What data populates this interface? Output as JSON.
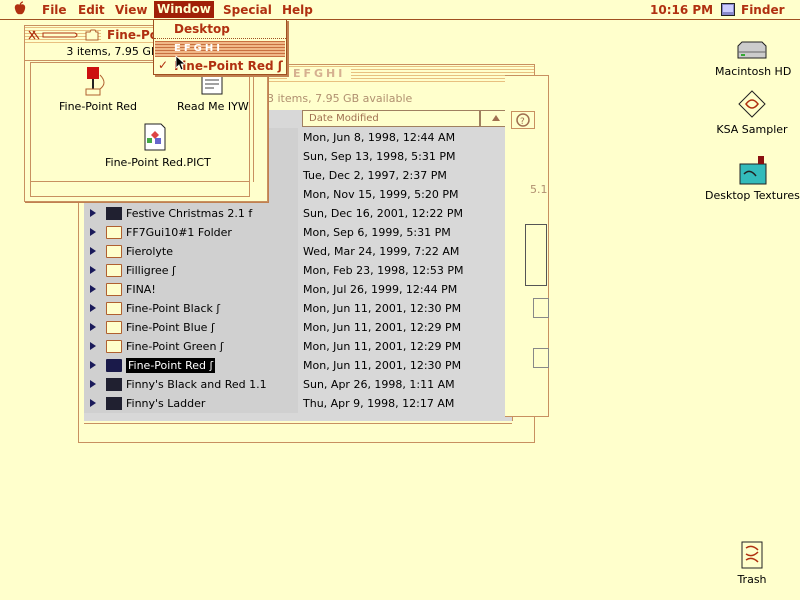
{
  "menubar": {
    "items": [
      "File",
      "Edit",
      "View",
      "Window",
      "Special",
      "Help"
    ],
    "time": "10:16 PM",
    "app": "Finder"
  },
  "window_menu": {
    "items": [
      "Desktop",
      "EFGHI",
      "Fine-Point Red ʃ"
    ]
  },
  "front_window": {
    "title": "Fine-Point Red ʃ",
    "info": "3 items, 7.95 GB available",
    "files": [
      "Fine-Point Red",
      "Read Me IYW",
      "Fine-Point Red.PICT"
    ]
  },
  "back_window": {
    "title": "EFGHI",
    "info": "3 items, 7.95 GB available",
    "column_date": "Date Modified",
    "rows": [
      {
        "name": "",
        "date": "Mon, Jun 8, 1998, 12:44 AM"
      },
      {
        "name": "",
        "date": "Sun, Sep 13, 1998, 5:31 PM"
      },
      {
        "name": "",
        "date": "Tue, Dec 2, 1997, 2:37 PM"
      },
      {
        "name": "",
        "date": "Mon, Nov 15, 1999, 5:20 PM"
      },
      {
        "name": "Festive Christmas 2.1 f",
        "date": "Sun, Dec 16, 2001, 12:22 PM"
      },
      {
        "name": "FF7Gui10#1 Folder",
        "date": "Mon, Sep 6, 1999, 5:31 PM"
      },
      {
        "name": "Fierolyte",
        "date": "Wed, Mar 24, 1999, 7:22 AM"
      },
      {
        "name": "Filligree ʃ",
        "date": "Mon, Feb 23, 1998, 12:53 PM"
      },
      {
        "name": "FINA!",
        "date": "Mon, Jul 26, 1999, 12:44 PM"
      },
      {
        "name": "Fine-Point Black ʃ",
        "date": "Mon, Jun 11, 2001, 12:30 PM"
      },
      {
        "name": "Fine-Point Blue ʃ",
        "date": "Mon, Jun 11, 2001, 12:29 PM"
      },
      {
        "name": "Fine-Point Green ʃ",
        "date": "Mon, Jun 11, 2001, 12:29 PM"
      },
      {
        "name": "Fine-Point Red ʃ",
        "date": "Mon, Jun 11, 2001, 12:30 PM"
      },
      {
        "name": "Finny's Black and Red 1.1",
        "date": "Sun, Apr 26, 1998, 1:11 AM"
      },
      {
        "name": "Finny's Ladder",
        "date": "Thu, Apr 9, 1998, 12:17 AM"
      }
    ]
  },
  "mid_window": {
    "fragment": "5.1"
  },
  "desktop_icons": [
    "Macintosh HD",
    "KSA Sampler",
    "Desktop Textures",
    "Trash"
  ],
  "colors": {
    "accent": "#b03010",
    "desktop": "#ffffcc",
    "selection": "#000000"
  }
}
